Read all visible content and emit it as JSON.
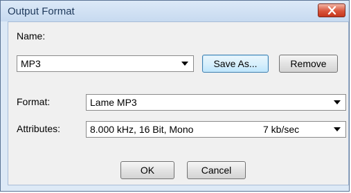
{
  "window": {
    "title": "Output Format"
  },
  "name_field": {
    "label": "Name:",
    "value": "MP3"
  },
  "buttons": {
    "save_as": "Save As...",
    "remove": "Remove",
    "ok": "OK",
    "cancel": "Cancel"
  },
  "format_field": {
    "label": "Format:",
    "value": "Lame MP3"
  },
  "attributes_field": {
    "label": "Attributes:",
    "value": "8.000 kHz, 16 Bit, Mono",
    "rate": "7 kb/sec"
  },
  "icons": {
    "close": "close-icon",
    "dropdown": "chevron-down-icon"
  },
  "colors": {
    "titlebar": "#c7daf0",
    "close_button": "#d9553b",
    "dialog_background": "#f0f0f0",
    "focused_button_border": "#3c7fb1"
  }
}
